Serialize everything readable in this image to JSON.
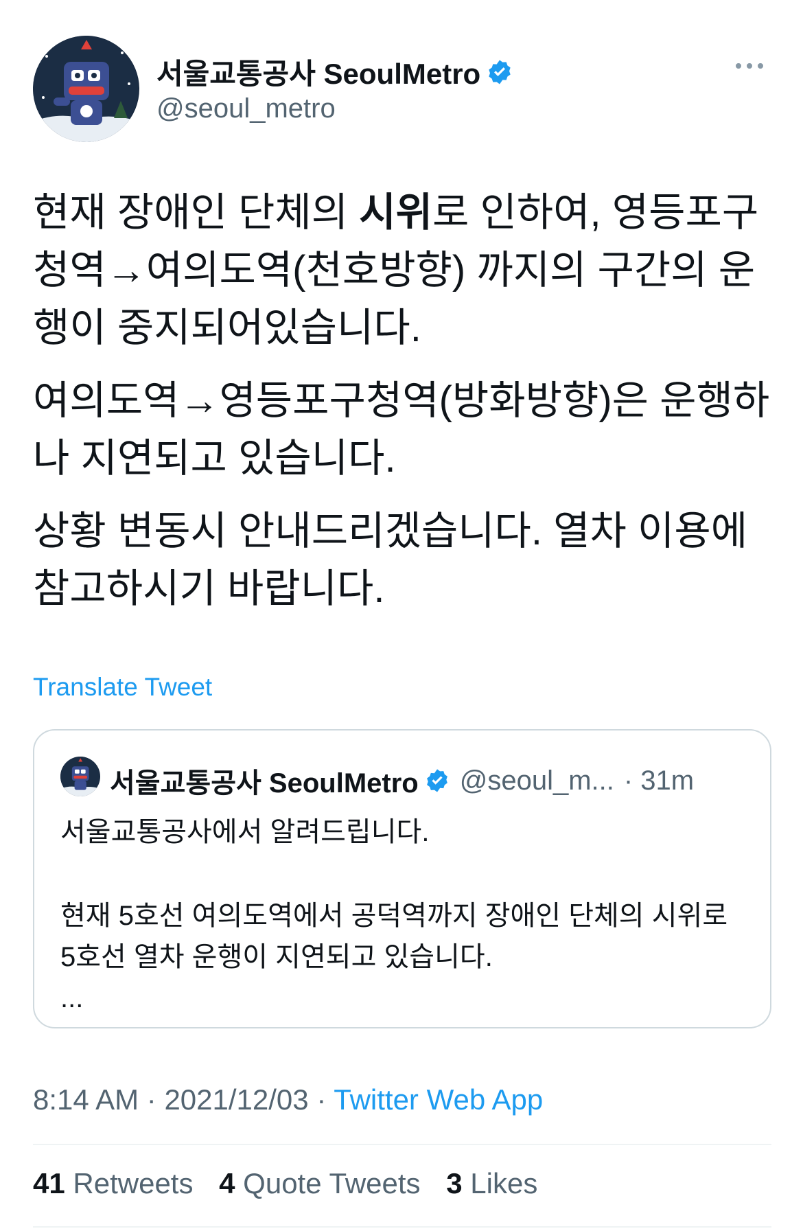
{
  "author": {
    "display_name": "서울교통공사 SeoulMetro",
    "handle": "@seoul_metro"
  },
  "tweet": {
    "p1_before": "현재 장애인 단체의 ",
    "p1_bold": "시위",
    "p1_after": "로 인하여, 영등포구청역→여의도역(천호방향) 까지의 구간의 운행이 중지되어있습니다.",
    "p2": "여의도역→영등포구청역(방화방향)은 운행하나 지연되고 있습니다.",
    "p3": "상황 변동시 안내드리겠습니다. 열차 이용에 참고하시기 바랍니다."
  },
  "translate_label": "Translate Tweet",
  "quote": {
    "display_name": "서울교통공사 SeoulMetro",
    "handle": "@seoul_m...",
    "time": "· 31m",
    "line1": "서울교통공사에서 알려드립니다.",
    "line2": "현재 5호선 여의도역에서 공덕역까지 장애인 단체의 시위로 5호선 열차 운행이 지연되고 있습니다.",
    "ellipsis": "..."
  },
  "meta": {
    "time": "8:14 AM",
    "sep1": " · ",
    "date": "2021/12/03",
    "sep2": " · ",
    "source": "Twitter Web App"
  },
  "stats": {
    "retweets_count": "41",
    "retweets_label": "Retweets",
    "quotes_count": "4",
    "quotes_label": "Quote Tweets",
    "likes_count": "3",
    "likes_label": "Likes"
  },
  "colors": {
    "accent": "#1d9bf0",
    "text": "#0f1419",
    "secondary": "#536471",
    "border": "#cfd9de"
  },
  "icons": [
    "avatar-mascot",
    "verified-badge-icon",
    "more-icon"
  ]
}
